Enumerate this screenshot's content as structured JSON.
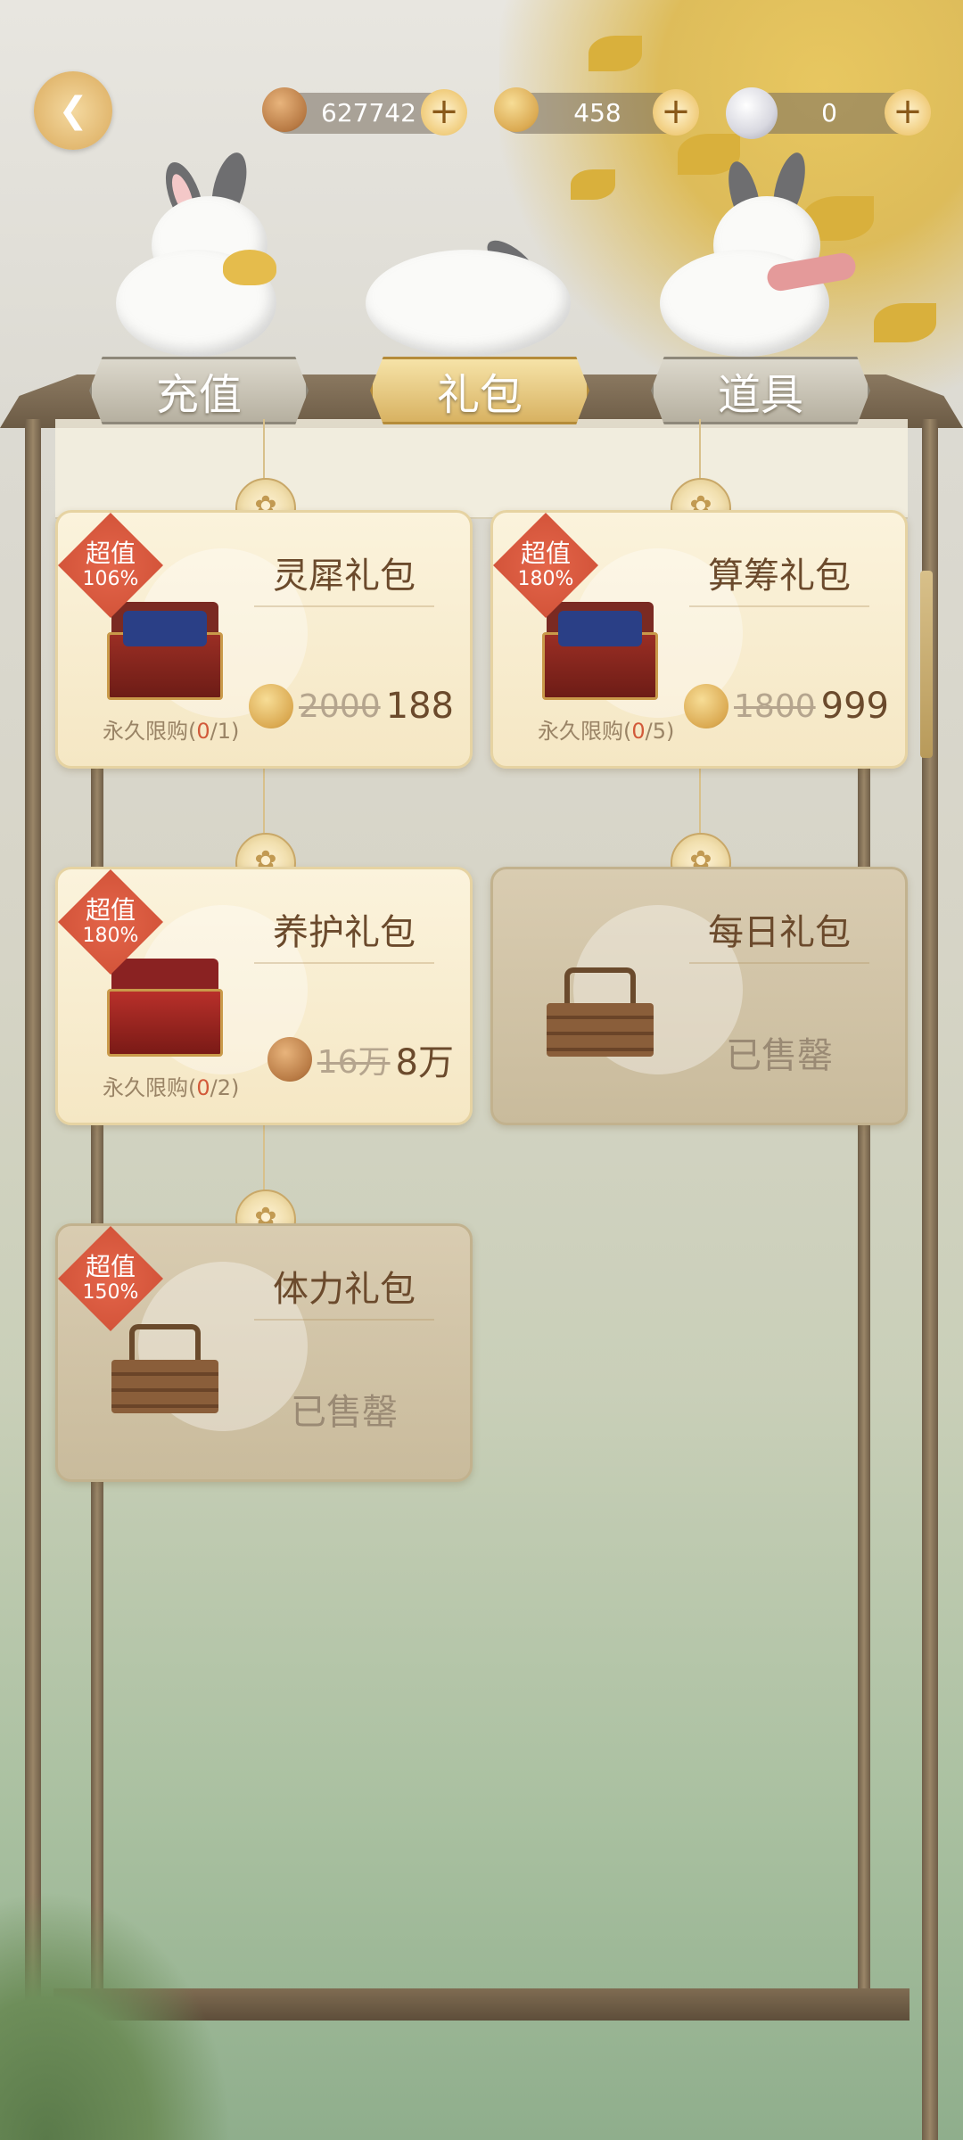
{
  "currencies": [
    {
      "name": "copper-coin",
      "value": "627742"
    },
    {
      "name": "gold-coin",
      "value": "458"
    },
    {
      "name": "pearl",
      "value": "0"
    }
  ],
  "tabs": [
    {
      "label": "充值",
      "active": false
    },
    {
      "label": "礼包",
      "active": true
    },
    {
      "label": "道具",
      "active": false
    }
  ],
  "packs": [
    {
      "title": "灵犀礼包",
      "badge_l1": "超值",
      "badge_l2": "106%",
      "limit_prefix": "永久限购(",
      "limit_count": "0",
      "limit_suffix": "/1)",
      "old_price": "2000",
      "new_price": "188",
      "currency": "gold-coin",
      "sold_out": false
    },
    {
      "title": "算筹礼包",
      "badge_l1": "超值",
      "badge_l2": "180%",
      "limit_prefix": "永久限购(",
      "limit_count": "0",
      "limit_suffix": "/5)",
      "old_price": "1800",
      "new_price": "999",
      "currency": "gold-coin",
      "sold_out": false
    },
    {
      "title": "养护礼包",
      "badge_l1": "超值",
      "badge_l2": "180%",
      "limit_prefix": "永久限购(",
      "limit_count": "0",
      "limit_suffix": "/2)",
      "old_price": "16万",
      "new_price": "8万",
      "currency": "copper-coin",
      "sold_out": false
    },
    {
      "title": "每日礼包",
      "sold_text": "已售罄",
      "sold_out": true
    },
    {
      "title": "体力礼包",
      "badge_l1": "超值",
      "badge_l2": "150%",
      "sold_text": "已售罄",
      "sold_out": true
    }
  ]
}
